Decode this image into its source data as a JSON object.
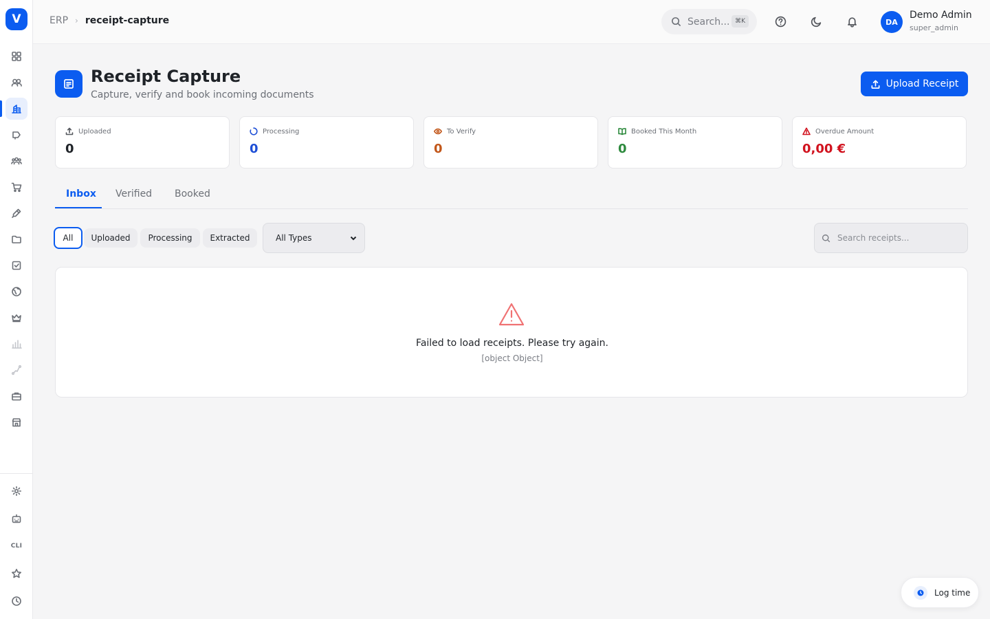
{
  "sidebar": {
    "logo": "V",
    "icons": [
      "dashboard-icon",
      "contacts-icon",
      "finance-icon",
      "marketing-icon",
      "team-icon",
      "cart-icon",
      "pen-icon",
      "folder-icon",
      "tasks-icon",
      "globe-icon",
      "crown-icon",
      "chart-icon",
      "flow-icon",
      "briefcase-icon",
      "store-icon"
    ],
    "cli_label": "CLI"
  },
  "header": {
    "breadcrumb_root": "ERP",
    "breadcrumb_current": "receipt-capture",
    "search_placeholder": "Search...",
    "search_shortcut": "⌘K",
    "user_initials": "DA",
    "user_name": "Demo Admin",
    "user_role": "super_admin"
  },
  "page": {
    "title": "Receipt Capture",
    "subtitle": "Capture, verify and book incoming documents",
    "upload_label": "Upload Receipt"
  },
  "stats": [
    {
      "label": "Uploaded",
      "value": "0",
      "color": "#1f2328"
    },
    {
      "label": "Processing",
      "value": "0",
      "color": "#1e4fd6"
    },
    {
      "label": "To Verify",
      "value": "0",
      "color": "#c2571a"
    },
    {
      "label": "Booked This Month",
      "value": "0",
      "color": "#2e8a3e"
    },
    {
      "label": "Overdue Amount",
      "value": "0,00 €",
      "color": "#d1121e"
    }
  ],
  "tabs": [
    "Inbox",
    "Verified",
    "Booked"
  ],
  "filters": {
    "chips": [
      "All",
      "Uploaded",
      "Processing",
      "Extracted"
    ],
    "type_selected": "All Types",
    "search_placeholder": "Search receipts..."
  },
  "error": {
    "message": "Failed to load receipts. Please try again.",
    "detail": "[object Object]"
  },
  "log_time_label": "Log time",
  "colors": {
    "accent": "#0b5cf0",
    "error": "#f07273"
  }
}
